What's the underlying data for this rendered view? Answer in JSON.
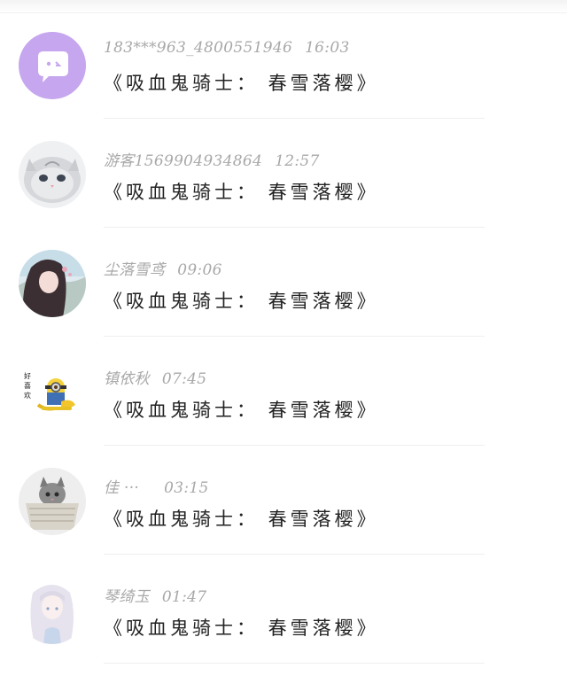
{
  "messages": [
    {
      "name": "183***963_4800551946",
      "time": "16:03",
      "text": "《吸血鬼骑士： 春雪落樱》",
      "avatar": "purple-chat-bubble"
    },
    {
      "name": "游客1569904934864",
      "time": "12:57",
      "text": "《吸血鬼骑士： 春雪落樱》",
      "avatar": "grey-cat"
    },
    {
      "name": "尘落雪鸢",
      "time": "09:06",
      "text": "《吸血鬼骑士： 春雪落樱》",
      "avatar": "anime-girl-dark-hair"
    },
    {
      "name": "镇依秋",
      "time": "07:45",
      "text": "《吸血鬼骑士： 春雪落樱》",
      "avatar": "minion-with-bananas"
    },
    {
      "name": "佳 ···",
      "time": "03:15",
      "text": "《吸血鬼骑士： 春雪落樱》",
      "avatar": "kitten-in-basket"
    },
    {
      "name": "琴绮玉",
      "time": "01:47",
      "text": "《吸血鬼骑士： 春雪落樱》",
      "avatar": "anime-girl-white-hair"
    }
  ],
  "avatar_texts": {
    "minion_caption": "好喜欢"
  }
}
